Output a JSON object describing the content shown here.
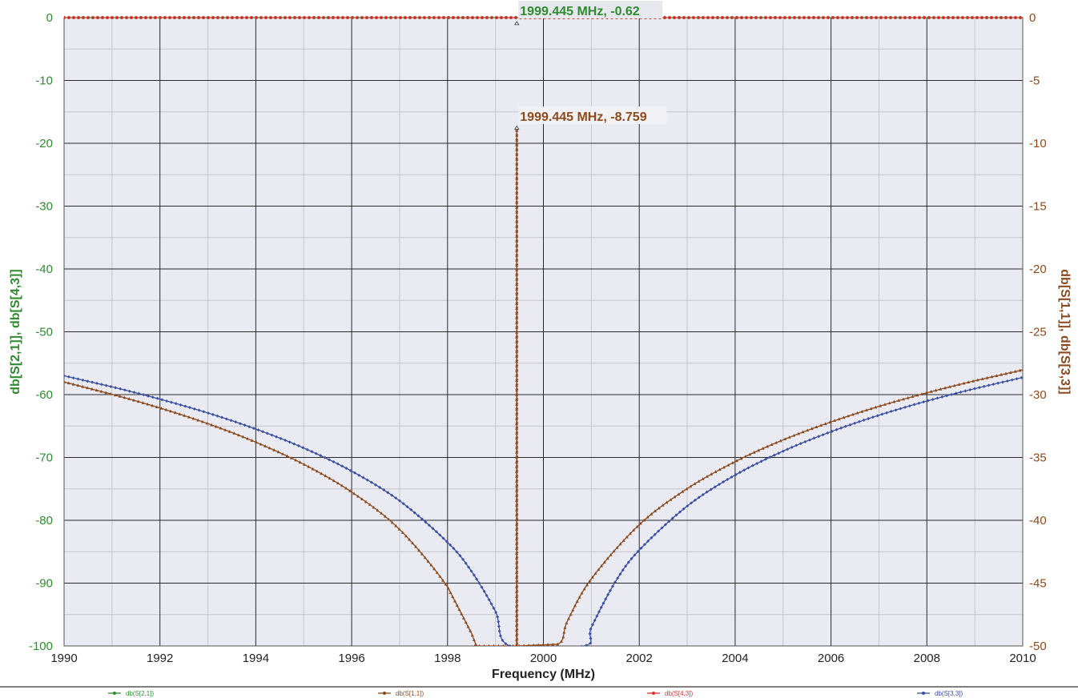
{
  "chart_data": {
    "type": "line",
    "xlabel": "Frequency (MHz)",
    "ylabel_left": "db[S[2,1]], db[S[4,3]]",
    "ylabel_right": "db[S[1,1]], db[S[3,3]]",
    "xlim": [
      1990,
      2010
    ],
    "ylim_left": [
      -100,
      0
    ],
    "ylim_right": [
      -50,
      0
    ],
    "x_ticks": [
      "1990",
      "1992",
      "1994",
      "1996",
      "1998",
      "2000",
      "2002",
      "2004",
      "2006",
      "2008",
      "2010"
    ],
    "y_ticks_left": [
      "0",
      "-10",
      "-20",
      "-30",
      "-40",
      "-50",
      "-60",
      "-70",
      "-80",
      "-90",
      "-100"
    ],
    "y_ticks_right": [
      "0",
      "-5",
      "-10",
      "-15",
      "-20",
      "-25",
      "-30",
      "-35",
      "-40",
      "-45",
      "-50"
    ],
    "grid": true,
    "legend_position": "bottom",
    "series": [
      {
        "name": "db(S[2,1])",
        "axis": "left",
        "color": "#2e8b2e",
        "style": "solid-markers",
        "x": [
          1990,
          2010
        ],
        "y": [
          0,
          0
        ]
      },
      {
        "name": "db(S[1,1])",
        "axis": "right",
        "color": "#8b4a1e",
        "style": "solid-triangles",
        "x": [
          1990,
          1991,
          1992,
          1993,
          1994,
          1995,
          1996,
          1997,
          1998,
          1998.5,
          1998.6,
          1999.44,
          1999.445,
          1999.45,
          2000.3,
          2000.5,
          2001,
          2002,
          2003,
          2004,
          2005,
          2006,
          2007,
          2008,
          2009,
          2010
        ],
        "y": [
          -28.99,
          -29.97,
          -31.06,
          -32.31,
          -33.78,
          -35.54,
          -37.75,
          -40.73,
          -45.3,
          -48.99,
          -50,
          -50,
          -8.759,
          -50,
          -49.86,
          -48.03,
          -44.66,
          -40.35,
          -37.48,
          -35.33,
          -33.6,
          -32.17,
          -30.93,
          -29.85,
          -28.89,
          -28.03
        ]
      },
      {
        "name": "db(S[4,3])",
        "axis": "left",
        "color": "#e03030",
        "style": "dashed",
        "x": [
          1990,
          2010
        ],
        "y": [
          0,
          0
        ]
      },
      {
        "name": "db(S[3,3])",
        "axis": "right",
        "color": "#3a4fa0",
        "style": "solid-diamonds",
        "x": [
          1990,
          1991,
          1992,
          1993,
          1994,
          1995,
          1996,
          1997,
          1998,
          1998.5,
          1999,
          1999.3,
          2000.85,
          2001,
          2001.5,
          2002,
          2003,
          2004,
          2005,
          2006,
          2007,
          2008,
          2009,
          2010
        ],
        "y": [
          -28.5,
          -29.38,
          -30.36,
          -31.46,
          -32.74,
          -34.25,
          -36.09,
          -38.45,
          -41.75,
          -44.06,
          -47.26,
          -50,
          -50,
          -48.52,
          -44.9,
          -42.37,
          -38.87,
          -36.4,
          -34.5,
          -32.95,
          -31.64,
          -30.51,
          -29.52,
          -28.63
        ]
      }
    ],
    "annotations": [
      {
        "text": "1999.445 MHz, -0.62",
        "color": "#2e8b2e",
        "x": 1999.445,
        "y": -0.62,
        "axis": "left"
      },
      {
        "text": "1999.445 MHz, -8.759",
        "color": "#8b4a1e",
        "x": 1999.445,
        "y": -8.759,
        "axis": "right"
      }
    ]
  }
}
